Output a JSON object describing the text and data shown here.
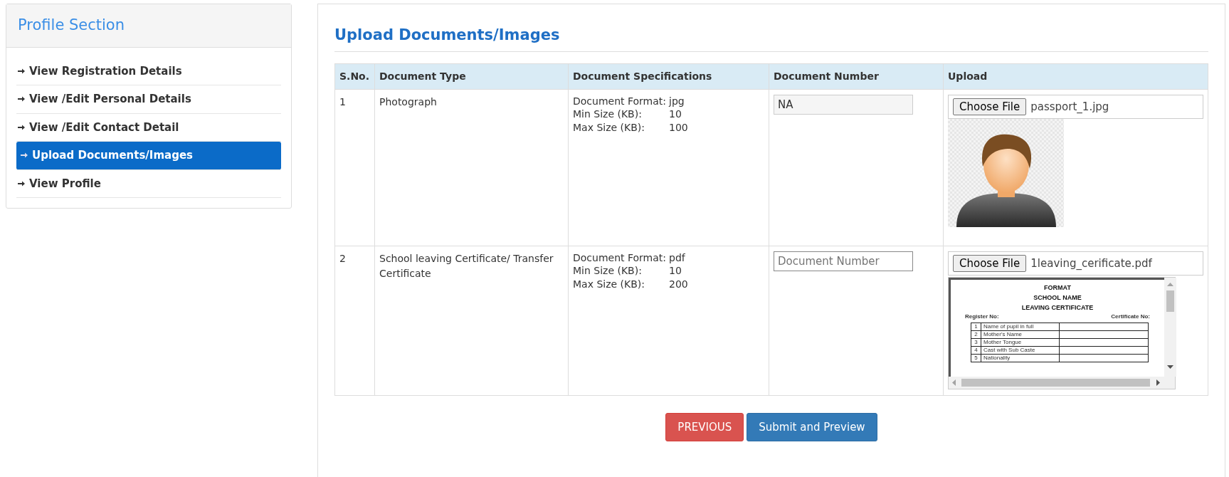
{
  "sidebar": {
    "title": "Profile Section",
    "items": [
      {
        "label": "View Registration Details",
        "selected": false
      },
      {
        "label": "View /Edit Personal Details",
        "selected": false
      },
      {
        "label": "View /Edit Contact Detail",
        "selected": false
      },
      {
        "label": "Upload Documents/Images",
        "selected": true
      },
      {
        "label": "View Profile",
        "selected": false
      }
    ]
  },
  "main": {
    "heading": "Upload Documents/Images",
    "table": {
      "columns": [
        "S.No.",
        "Document Type",
        "Document Specifications",
        "Document Number",
        "Upload"
      ],
      "rows": [
        {
          "sno": "1",
          "document_type": "Photograph",
          "specs": [
            {
              "label": "Document Format:",
              "value": "jpg"
            },
            {
              "label": "Min Size (KB):",
              "value": "10"
            },
            {
              "label": "Max Size (KB):",
              "value": "100"
            }
          ],
          "document_number": {
            "value": "NA",
            "disabled": true
          },
          "upload": {
            "button": "Choose File",
            "filename": "passport_1.jpg",
            "preview": {
              "kind": "image"
            }
          }
        },
        {
          "sno": "2",
          "document_type": "School leaving Certificate/ Transfer Certificate",
          "specs": [
            {
              "label": "Document Format:",
              "value": "pdf"
            },
            {
              "label": "Min Size (KB):",
              "value": "10"
            },
            {
              "label": "Max Size (KB):",
              "value": "200"
            }
          ],
          "document_number": {
            "placeholder": "Document Number",
            "disabled": false
          },
          "upload": {
            "button": "Choose File",
            "filename": "1leaving_cerificate.pdf",
            "preview": {
              "kind": "pdf",
              "titles": [
                "FORMAT",
                "SCHOOL NAME",
                "LEAVING CERTIFICATE"
              ],
              "register": "Register No:",
              "certificate": "Certificate No:",
              "rows": [
                {
                  "no": "1",
                  "label": "Name of pupil in full"
                },
                {
                  "no": "2",
                  "label": "Mother's Name"
                },
                {
                  "no": "3",
                  "label": "Mother Tongue"
                },
                {
                  "no": "4",
                  "label": "Cast with Sub Caste"
                },
                {
                  "no": "5",
                  "label": "Nationality"
                }
              ]
            }
          }
        }
      ]
    },
    "buttons": [
      {
        "label": "PREVIOUS",
        "kind": "danger"
      },
      {
        "label": "Submit and Preview",
        "kind": "primary"
      }
    ]
  }
}
